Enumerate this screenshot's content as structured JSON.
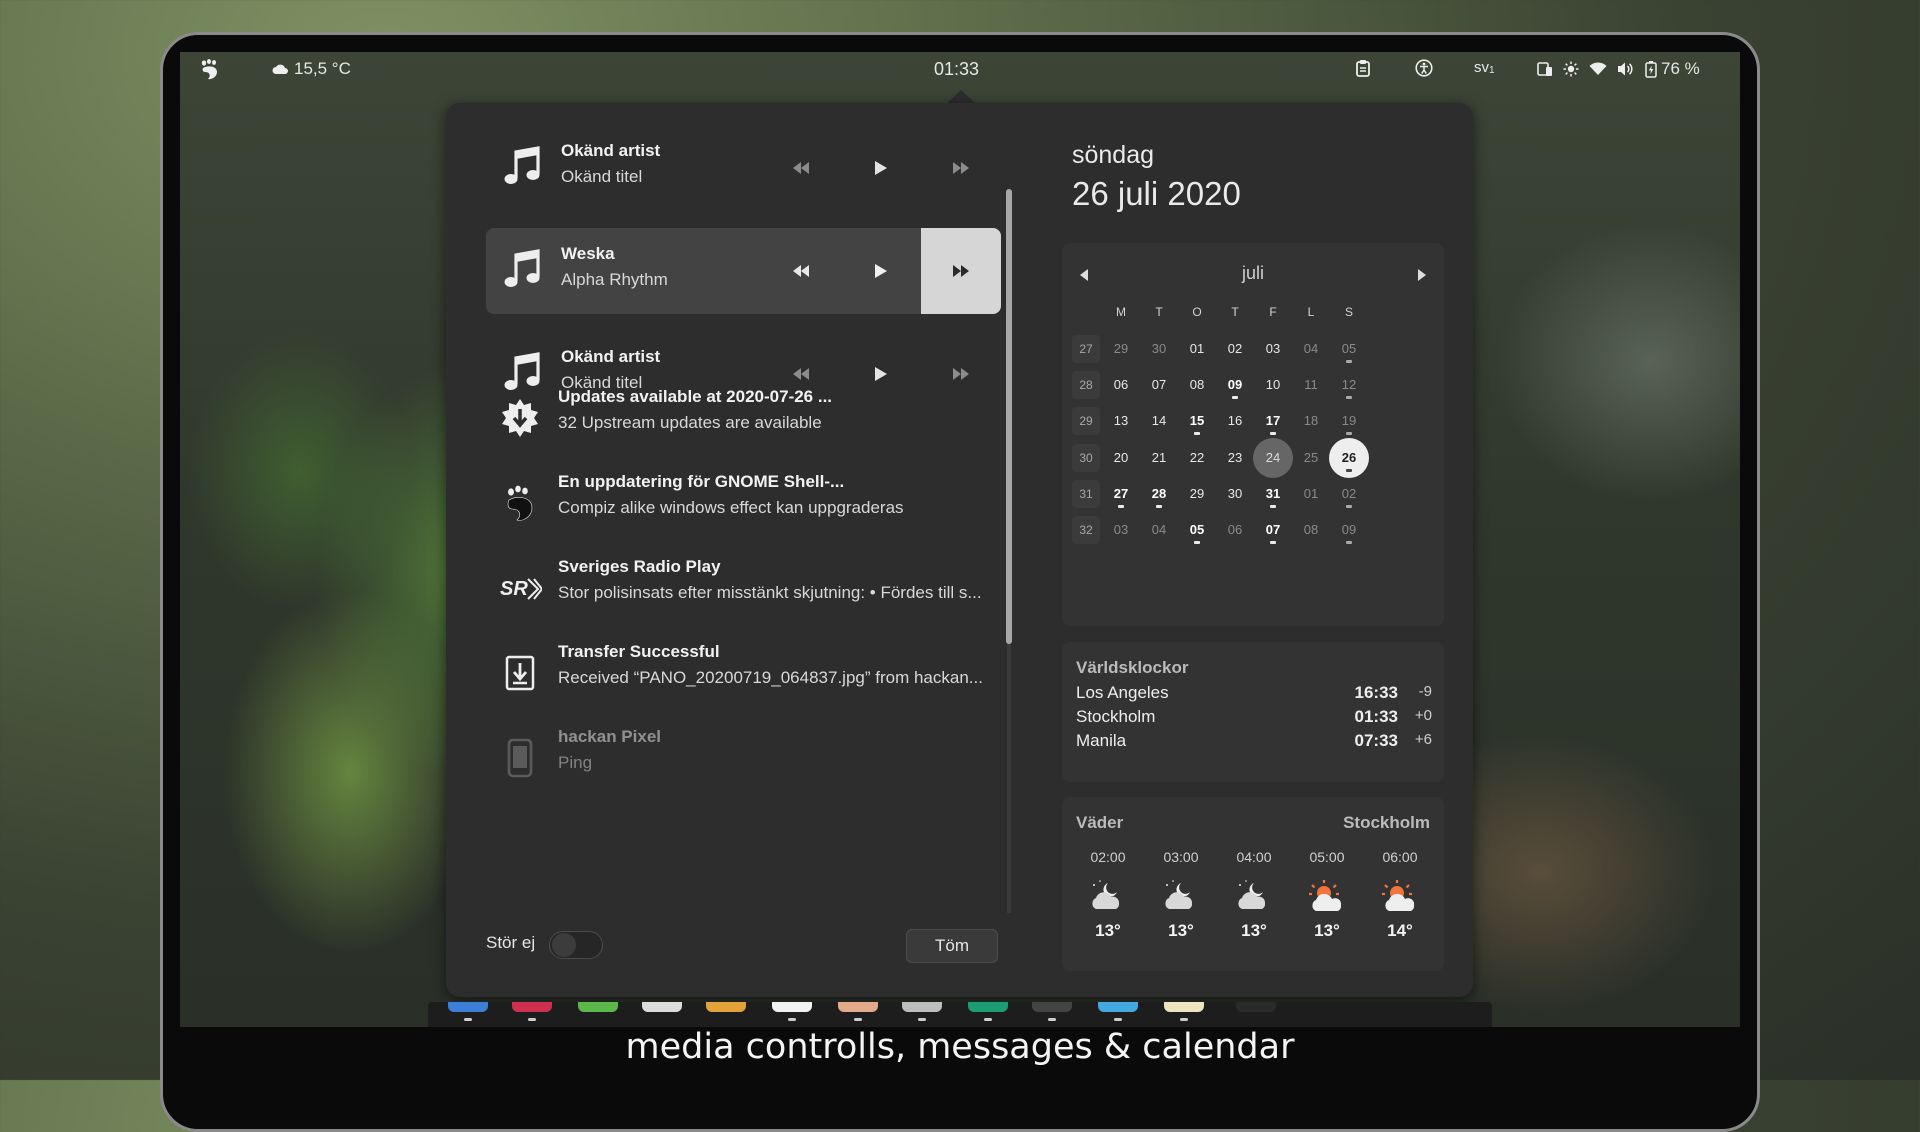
{
  "topbar": {
    "weather_temp": "15,5 °C",
    "clock": "01:33",
    "keyboard_layout": "sv",
    "keyboard_layout_sub": "1",
    "battery": "76 %"
  },
  "media": [
    {
      "artist": "Okänd artist",
      "title": "Okänd titel",
      "active": false
    },
    {
      "artist": "Weska",
      "title": "Alpha Rhythm",
      "active": true
    },
    {
      "artist": "Okänd artist",
      "title": "Okänd titel",
      "active": false
    }
  ],
  "notifications": [
    {
      "icon": "software-update-icon",
      "title": "Updates available at 2020-07-26 ...",
      "body": "32 Upstream updates are available"
    },
    {
      "icon": "gnome-foot-icon",
      "title": "En uppdatering för GNOME Shell-...",
      "body": "Compiz alike windows effect kan uppgraderas"
    },
    {
      "icon": "sveriges-radio-icon",
      "title": "Sveriges Radio Play",
      "body": "Stor polisinsats efter misstänkt skjutning: • Fördes till s..."
    },
    {
      "icon": "download-icon",
      "title": "Transfer Successful",
      "body": "Received “PANO_20200719_064837.jpg” from hackan..."
    },
    {
      "icon": "phone-icon",
      "title": "hackan Pixel",
      "body": "Ping"
    }
  ],
  "footer": {
    "dnd_label": "Stör ej",
    "clear_label": "Töm"
  },
  "date": {
    "weekday": "söndag",
    "full": "26 juli 2020"
  },
  "calendar": {
    "month": "juli",
    "day_headers": [
      "M",
      "T",
      "O",
      "T",
      "F",
      "L",
      "S"
    ],
    "weeks": [
      {
        "num": "27",
        "days": [
          {
            "d": "29",
            "other": true
          },
          {
            "d": "30",
            "other": true
          },
          {
            "d": "01"
          },
          {
            "d": "02"
          },
          {
            "d": "03"
          },
          {
            "d": "04",
            "other": true
          },
          {
            "d": "05",
            "other": true,
            "event": true
          }
        ]
      },
      {
        "num": "28",
        "days": [
          {
            "d": "06"
          },
          {
            "d": "07"
          },
          {
            "d": "08"
          },
          {
            "d": "09",
            "bold": true,
            "event": true
          },
          {
            "d": "10"
          },
          {
            "d": "11",
            "other": true
          },
          {
            "d": "12",
            "other": true,
            "event": true
          }
        ]
      },
      {
        "num": "29",
        "days": [
          {
            "d": "13"
          },
          {
            "d": "14"
          },
          {
            "d": "15",
            "bold": true,
            "event": true
          },
          {
            "d": "16"
          },
          {
            "d": "17",
            "bold": true,
            "event": true
          },
          {
            "d": "18",
            "other": true
          },
          {
            "d": "19",
            "other": true,
            "event": true
          }
        ]
      },
      {
        "num": "30",
        "days": [
          {
            "d": "20"
          },
          {
            "d": "21"
          },
          {
            "d": "22"
          },
          {
            "d": "23"
          },
          {
            "d": "24",
            "selected": true
          },
          {
            "d": "25",
            "other": true
          },
          {
            "d": "26",
            "today": true,
            "event": true
          }
        ]
      },
      {
        "num": "31",
        "days": [
          {
            "d": "27",
            "bold": true,
            "event": true
          },
          {
            "d": "28",
            "bold": true,
            "event": true
          },
          {
            "d": "29"
          },
          {
            "d": "30"
          },
          {
            "d": "31",
            "bold": true,
            "event": true
          },
          {
            "d": "01",
            "other": true
          },
          {
            "d": "02",
            "other": true,
            "event": true
          }
        ]
      },
      {
        "num": "32",
        "days": [
          {
            "d": "03",
            "other": true
          },
          {
            "d": "04",
            "other": true
          },
          {
            "d": "05",
            "bold": true,
            "event": true
          },
          {
            "d": "06",
            "other": true
          },
          {
            "d": "07",
            "bold": true,
            "event": true
          },
          {
            "d": "08",
            "other": true
          },
          {
            "d": "09",
            "other": true,
            "event": true
          }
        ]
      }
    ]
  },
  "world_clocks": {
    "title": "Världsklockor",
    "rows": [
      {
        "city": "Los Angeles",
        "time": "16:33",
        "offset": "-9"
      },
      {
        "city": "Stockholm",
        "time": "01:33",
        "offset": "+0"
      },
      {
        "city": "Manila",
        "time": "07:33",
        "offset": "+6"
      }
    ]
  },
  "weather": {
    "title": "Väder",
    "location": "Stockholm",
    "hours": [
      {
        "time": "02:00",
        "icon": "night-cloudy-icon",
        "temp": "13°"
      },
      {
        "time": "03:00",
        "icon": "night-cloudy-icon",
        "temp": "13°"
      },
      {
        "time": "04:00",
        "icon": "night-cloudy-icon",
        "temp": "13°"
      },
      {
        "time": "05:00",
        "icon": "sun-cloudy-icon",
        "temp": "13°"
      },
      {
        "time": "06:00",
        "icon": "sun-cloudy-icon",
        "temp": "14°"
      }
    ]
  },
  "caption": "media controlls, messages & calendar",
  "colors": {
    "panel_bg": "#2d2d2d",
    "card_bg": "#333333",
    "active_player": "#434343",
    "sun": "#f0743c"
  }
}
